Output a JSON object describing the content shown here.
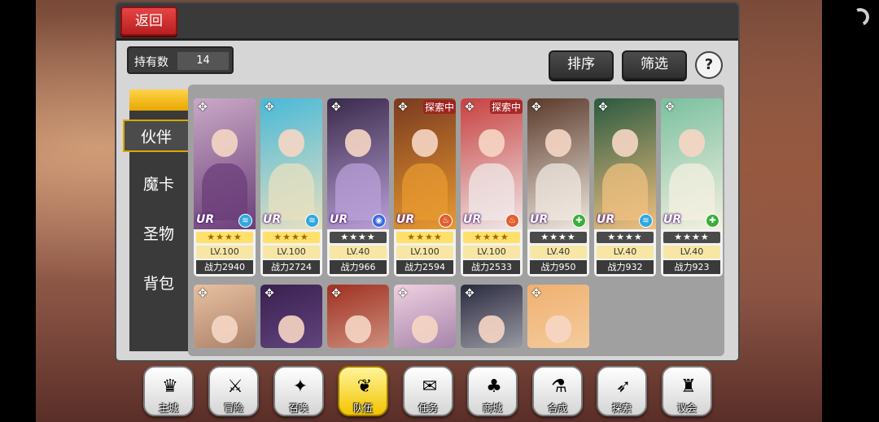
{
  "header": {
    "back_label": "返回"
  },
  "holdings": {
    "label": "持有数",
    "value": "14"
  },
  "toolbar": {
    "sort_label": "排序",
    "filter_label": "筛选",
    "help_label": "?"
  },
  "tabs": [
    {
      "label": "伙伴",
      "active": true
    },
    {
      "label": "魔卡",
      "active": false
    },
    {
      "label": "圣物",
      "active": false
    },
    {
      "label": "背包",
      "active": false
    }
  ],
  "cards": [
    {
      "rarity": "UR",
      "stars": "★★★★",
      "star_style": "gold",
      "level": "LV.100",
      "power": "战力2940",
      "status": "",
      "element_icon": "wind-icon",
      "colors": [
        "#c9a9c6",
        "#6b3e7a"
      ]
    },
    {
      "rarity": "UR",
      "stars": "★★★★",
      "star_style": "gold",
      "level": "LV.100",
      "power": "战力2724",
      "status": "",
      "element_icon": "wind-icon",
      "colors": [
        "#48b9d8",
        "#e8e0c0"
      ]
    },
    {
      "rarity": "UR",
      "stars": "★★★★",
      "star_style": "dark",
      "level": "LV.40",
      "power": "战力966",
      "status": "",
      "element_icon": "water-icon",
      "colors": [
        "#3a2a4a",
        "#b9a0d8"
      ]
    },
    {
      "rarity": "UR",
      "stars": "★★★★",
      "star_style": "gold",
      "level": "LV.100",
      "power": "战力2594",
      "status": "探索中",
      "element_icon": "fire-icon",
      "colors": [
        "#7a3a20",
        "#e89a30"
      ]
    },
    {
      "rarity": "UR",
      "stars": "★★★★",
      "star_style": "gold",
      "level": "LV.100",
      "power": "战力2533",
      "status": "探索中",
      "element_icon": "fire-icon",
      "colors": [
        "#c84040",
        "#f0e8e8"
      ]
    },
    {
      "rarity": "UR",
      "stars": "★★★★",
      "star_style": "dark",
      "level": "LV.40",
      "power": "战力950",
      "status": "",
      "element_icon": "wood-icon",
      "colors": [
        "#5a3a2a",
        "#f0e8e0"
      ]
    },
    {
      "rarity": "UR",
      "stars": "★★★★",
      "star_style": "dark",
      "level": "LV.40",
      "power": "战力932",
      "status": "",
      "element_icon": "wind-icon",
      "colors": [
        "#2a5a40",
        "#f0c080"
      ]
    },
    {
      "rarity": "UR",
      "stars": "★★★★",
      "star_style": "dark",
      "level": "LV.40",
      "power": "战力923",
      "status": "",
      "element_icon": "wood-icon",
      "colors": [
        "#7ac0a0",
        "#f4f0e0"
      ]
    }
  ],
  "cards_row2": [
    {
      "colors": [
        "#e8c0a0",
        "#7a5040"
      ]
    },
    {
      "colors": [
        "#3a2050",
        "#8060a0"
      ]
    },
    {
      "colors": [
        "#a03020",
        "#f0d8c8"
      ]
    },
    {
      "colors": [
        "#f0d0e0",
        "#6a4a80"
      ]
    },
    {
      "colors": [
        "#2a2a40",
        "#f0f0f0"
      ]
    },
    {
      "colors": [
        "#f0b070",
        "#f8e0c0"
      ]
    }
  ],
  "nav": [
    {
      "label": "主城",
      "icon": "castle-icon",
      "glyph": "♛",
      "active": false
    },
    {
      "label": "冒险",
      "icon": "crossed-swords-icon",
      "glyph": "⚔",
      "active": false
    },
    {
      "label": "召唤",
      "icon": "summon-cards-icon",
      "glyph": "✦",
      "active": false
    },
    {
      "label": "队伍",
      "icon": "team-wings-icon",
      "glyph": "❦",
      "active": true
    },
    {
      "label": "任务",
      "icon": "quest-book-icon",
      "glyph": "✉",
      "active": false
    },
    {
      "label": "商城",
      "icon": "shop-mushroom-icon",
      "glyph": "♣",
      "active": false
    },
    {
      "label": "合成",
      "icon": "alchemy-flask-icon",
      "glyph": "⚗",
      "active": false
    },
    {
      "label": "探索",
      "icon": "explore-bow-icon",
      "glyph": "➶",
      "active": false
    },
    {
      "label": "议会",
      "icon": "council-crown-icon",
      "glyph": "♜",
      "active": false
    }
  ]
}
